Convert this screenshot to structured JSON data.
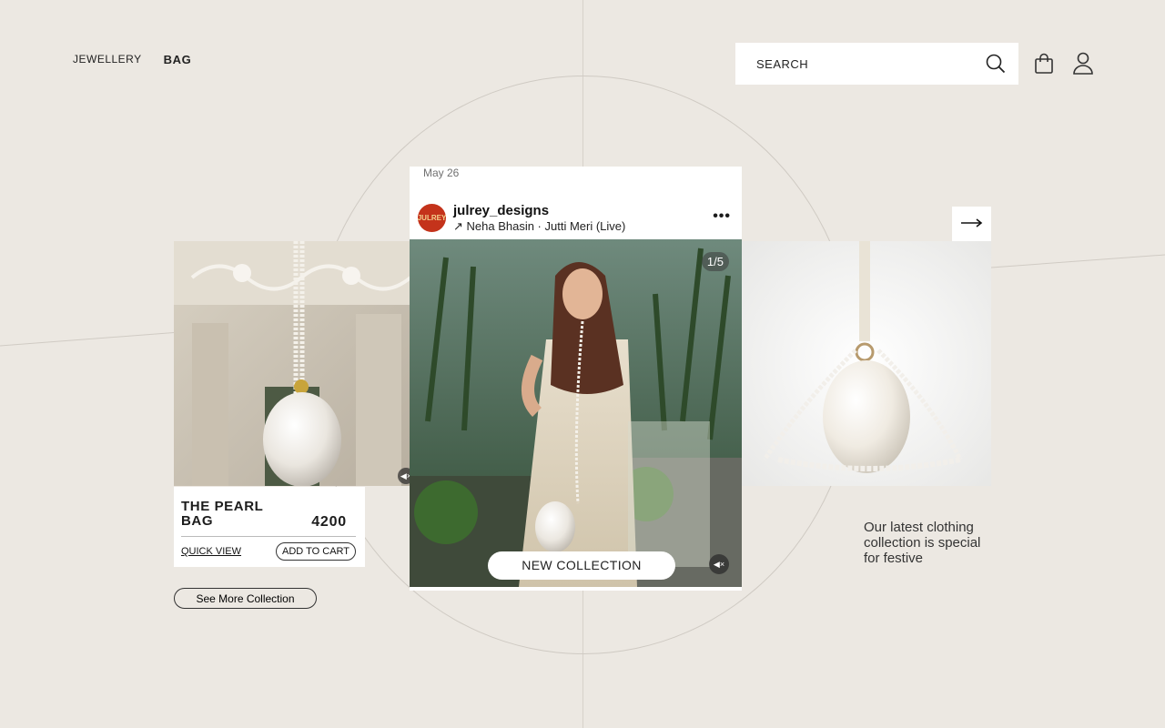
{
  "nav": {
    "jewellery": "JEWELLERY",
    "bag": "BAG"
  },
  "search": {
    "placeholder": "SEARCH",
    "icon": "search-icon"
  },
  "header_icons": [
    "shopping-bag-icon",
    "user-icon"
  ],
  "product": {
    "title": "THE PEARL BAG",
    "price": "4200",
    "quick_view": "QUICK VIEW",
    "add_to_cart": "ADD TO CART"
  },
  "see_more": "See More Collection",
  "post": {
    "date": "May 26",
    "avatar_text": "JULREY",
    "handle": "julrey_designs",
    "song": "↗ Neha Bhasin · Jutti Meri (Live)",
    "more": "•••",
    "counter": "1/5",
    "cta": "NEW COLLECTION"
  },
  "tagline": "Our latest clothing collection is special for festive",
  "colors": {
    "background": "#ece8e2",
    "avatar": "#c4331b"
  }
}
